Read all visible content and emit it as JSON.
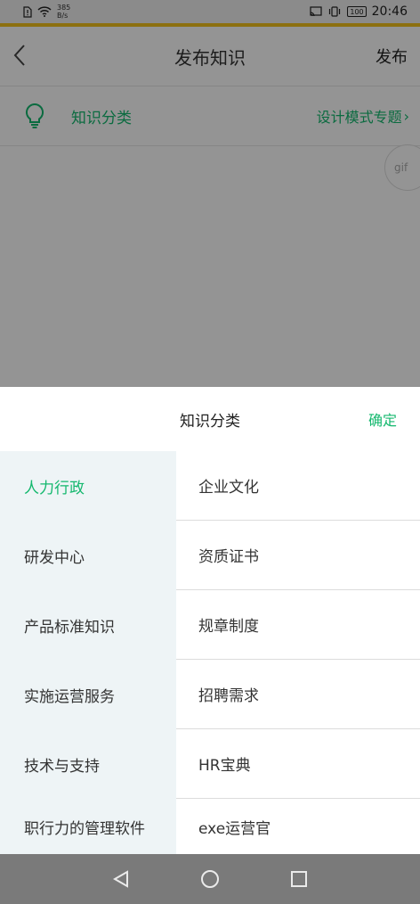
{
  "status_bar": {
    "net_speed_value": "385",
    "net_speed_unit": "B/s",
    "battery": "100",
    "time": "20:46",
    "icons": [
      "sim-alert-icon",
      "wifi-icon",
      "cast-icon",
      "vibrate-icon",
      "battery-icon"
    ]
  },
  "header": {
    "title": "发布知识",
    "publish_label": "发布"
  },
  "category_row": {
    "label": "知识分类",
    "value": "设计模式专题",
    "chevron": "›"
  },
  "gif_button": {
    "label": "gif"
  },
  "picker": {
    "title": "知识分类",
    "confirm_label": "确定",
    "left_items": [
      {
        "label": "人力行政",
        "active": true
      },
      {
        "label": "研发中心",
        "active": false
      },
      {
        "label": "产品标准知识",
        "active": false
      },
      {
        "label": "实施运营服务",
        "active": false
      },
      {
        "label": "技术与支持",
        "active": false
      },
      {
        "label": "职行力的管理软件",
        "active": false
      }
    ],
    "right_items": [
      {
        "label": "企业文化"
      },
      {
        "label": "资质证书"
      },
      {
        "label": "规章制度"
      },
      {
        "label": "招聘需求"
      },
      {
        "label": "HR宝典"
      },
      {
        "label": "exe运营官"
      }
    ]
  },
  "colors": {
    "accent_green": "#14b86e",
    "status_accent": "#f2c21a",
    "overlay": "rgba(0,0,0,0.42)",
    "left_col_bg": "#eef4f6"
  }
}
